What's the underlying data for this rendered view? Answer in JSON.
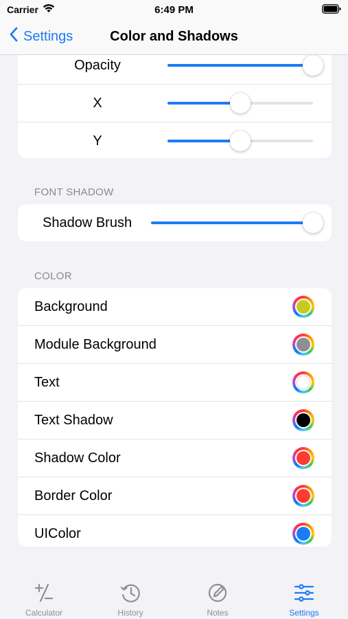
{
  "status_bar": {
    "carrier": "Carrier",
    "time": "6:49 PM"
  },
  "nav": {
    "back_label": "Settings",
    "title": "Color and Shadows"
  },
  "shadow_sliders": [
    {
      "label": "Opacity",
      "value": 1.0
    },
    {
      "label": "X",
      "value": 0.5
    },
    {
      "label": "Y",
      "value": 0.5
    }
  ],
  "font_shadow": {
    "header": "FONT SHADOW",
    "slider": {
      "label": "Shadow Brush",
      "value": 1.0
    }
  },
  "color": {
    "header": "COLOR",
    "items": [
      {
        "label": "Background",
        "color": "#c5cc1f"
      },
      {
        "label": "Module Background",
        "color": "#8e8e93"
      },
      {
        "label": "Text",
        "color": "#ffffff"
      },
      {
        "label": "Text Shadow",
        "color": "#000000"
      },
      {
        "label": "Shadow Color",
        "color": "#ff3b30"
      },
      {
        "label": "Border Color",
        "color": "#ff3b30"
      },
      {
        "label": "UIColor",
        "color": "#1a7cf5"
      }
    ]
  },
  "tabs": [
    {
      "label": "Calculator",
      "icon": "plus-minus-icon",
      "active": false
    },
    {
      "label": "History",
      "icon": "history-clock-icon",
      "active": false
    },
    {
      "label": "Notes",
      "icon": "note-pen-icon",
      "active": false
    },
    {
      "label": "Settings",
      "icon": "sliders-icon",
      "active": true
    }
  ],
  "accent_color": "#1a7cf5"
}
